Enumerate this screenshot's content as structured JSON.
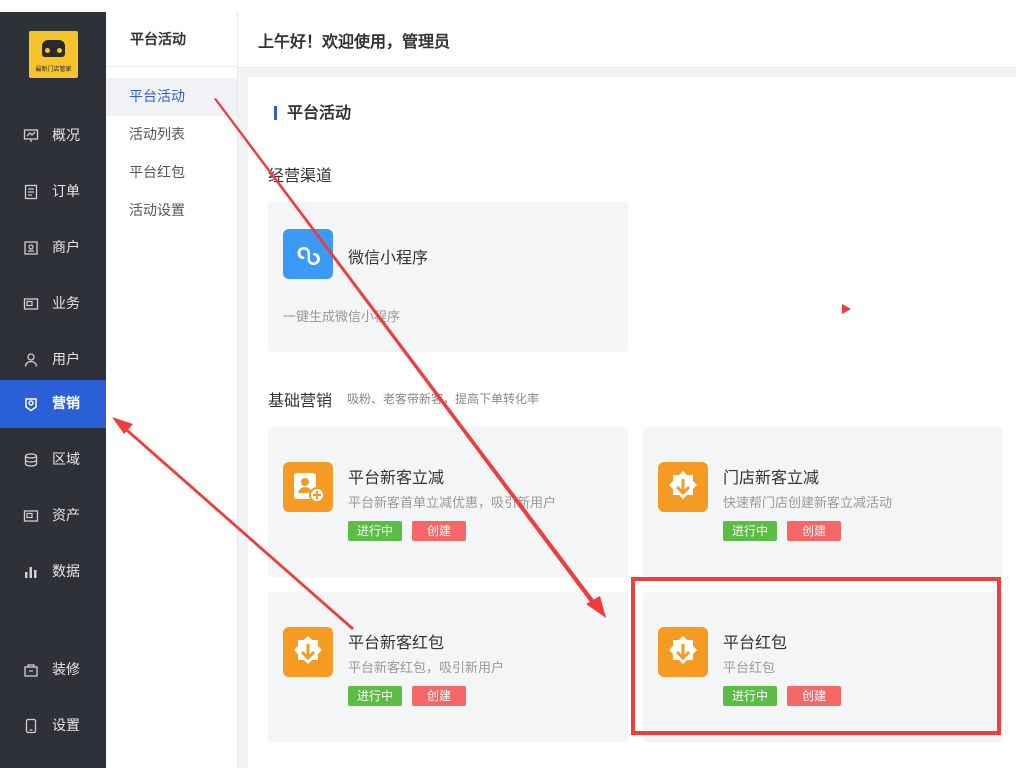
{
  "app": {
    "logo_text": "最新门店管家"
  },
  "sidebar": {
    "items": [
      {
        "label": "概况",
        "icon": "chart-icon"
      },
      {
        "label": "订单",
        "icon": "order-icon"
      },
      {
        "label": "商户",
        "icon": "shop-icon"
      },
      {
        "label": "业务",
        "icon": "business-icon"
      },
      {
        "label": "用户",
        "icon": "user-icon"
      },
      {
        "label": "营销",
        "icon": "marketing-icon",
        "active": true
      },
      {
        "label": "区域",
        "icon": "region-icon"
      },
      {
        "label": "资产",
        "icon": "asset-icon"
      },
      {
        "label": "数据",
        "icon": "data-icon"
      },
      {
        "label": "装修",
        "icon": "decorate-icon"
      },
      {
        "label": "设置",
        "icon": "settings-icon"
      }
    ]
  },
  "subnav": {
    "title": "平台活动",
    "items": [
      {
        "label": "平台活动",
        "active": true
      },
      {
        "label": "活动列表"
      },
      {
        "label": "平台红包"
      },
      {
        "label": "活动设置"
      }
    ]
  },
  "header": {
    "greeting": "上午好！欢迎使用，管理员"
  },
  "main": {
    "section_title": "平台活动",
    "channels": {
      "title": "经营渠道",
      "cards": [
        {
          "title": "微信小程序",
          "desc": "一键生成微信小程序",
          "icon": "mini-program-icon"
        }
      ]
    },
    "marketing": {
      "title": "基础营销",
      "subtitle": "吸粉、老客带新客，提高下单转化率",
      "cards": [
        {
          "title": "平台新客立减",
          "desc": "平台新客首单立减优惠，吸引新用户",
          "status": "进行中",
          "action": "创建",
          "icon": "new-customer-icon"
        },
        {
          "title": "门店新客立减",
          "desc": "快速帮门店创建新客立减活动",
          "status": "进行中",
          "action": "创建",
          "icon": "coupon-icon"
        },
        {
          "title": "平台新客红包",
          "desc": "平台新客红包，吸引新用户",
          "status": "进行中",
          "action": "创建",
          "icon": "coupon-icon"
        },
        {
          "title": "平台红包",
          "desc": "平台红包",
          "status": "进行中",
          "action": "创建",
          "icon": "coupon-icon"
        }
      ]
    }
  },
  "colors": {
    "primary": "#2b5fd6",
    "sidebar_bg": "#2e3137",
    "orange": "#f59a23",
    "green": "#5bbd45",
    "red": "#f56666",
    "annotation": "#f03c3c"
  }
}
